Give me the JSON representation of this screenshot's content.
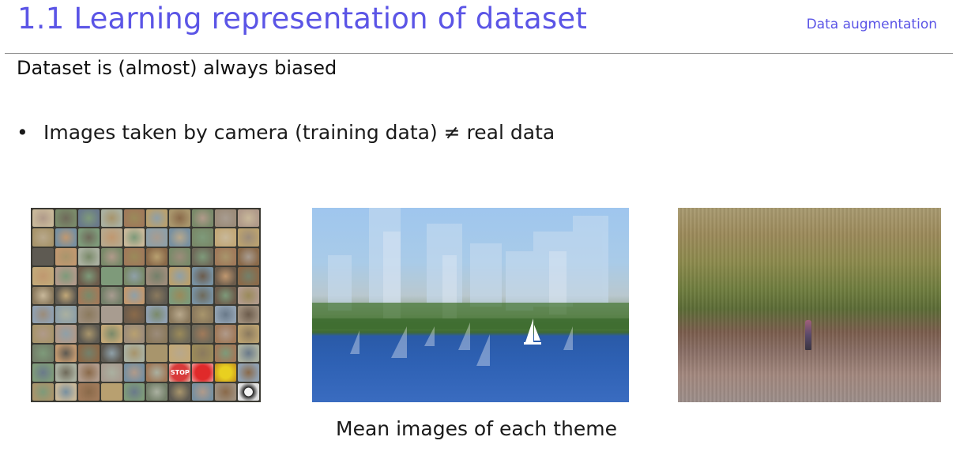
{
  "header": {
    "title": "1.1 Learning representation of dataset",
    "section_tag": "Data augmentation"
  },
  "content": {
    "subtitle": "Dataset is (almost) always biased",
    "bullets": [
      {
        "marker": "•",
        "text": "Images taken by camera (training data) ≠ real data"
      }
    ],
    "images": [
      {
        "name": "object-category-mean-grid",
        "stop_label": "STOP"
      },
      {
        "name": "city-harbor-mean-image"
      },
      {
        "name": "park-mean-image"
      }
    ],
    "caption": "Mean images of each theme"
  },
  "colors": {
    "title": "#5b55e6",
    "rule": "#8a8a8a",
    "text": "#111111"
  }
}
